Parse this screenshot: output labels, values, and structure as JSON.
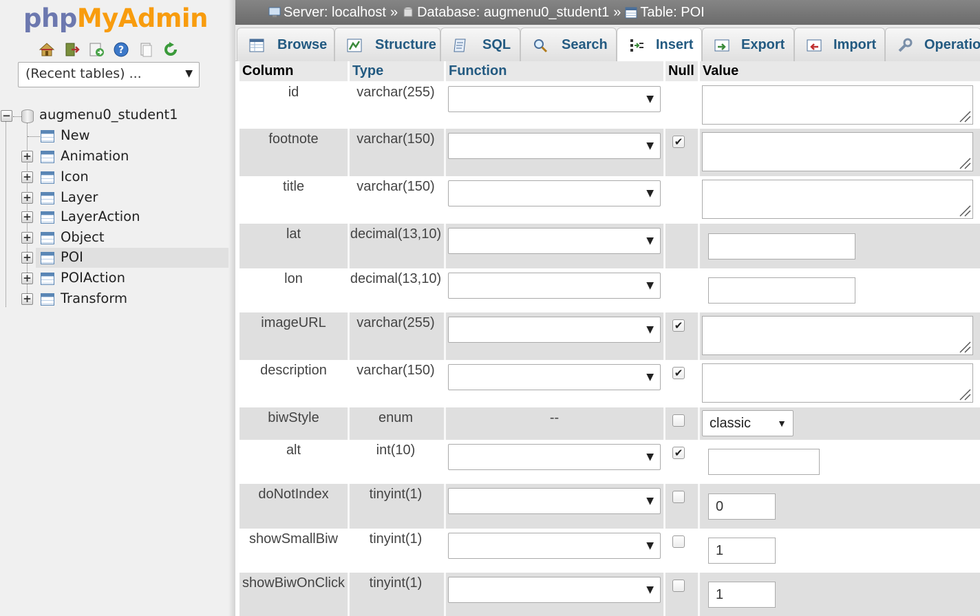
{
  "logo": {
    "part1": "php",
    "part2": "MyAdmin"
  },
  "nav_icons": [
    "home-icon",
    "exit-icon",
    "sql-query-icon",
    "help-icon",
    "documentation-icon",
    "reload-icon"
  ],
  "recent_tables": {
    "label": "(Recent tables) ...",
    "arrow": "▼"
  },
  "tree": {
    "database": "augmenu0_student1",
    "items": [
      {
        "label": "New"
      },
      {
        "label": "Animation"
      },
      {
        "label": "Icon"
      },
      {
        "label": "Layer"
      },
      {
        "label": "LayerAction"
      },
      {
        "label": "Object"
      },
      {
        "label": "POI"
      },
      {
        "label": "POIAction"
      },
      {
        "label": "Transform"
      }
    ]
  },
  "breadcrumb": {
    "server": "Server: localhost",
    "database": "Database: augmenu0_student1",
    "table": "Table: POI",
    "separator": "»"
  },
  "tabs": [
    {
      "label": "Browse",
      "icon": "browse-icon"
    },
    {
      "label": "Structure",
      "icon": "structure-icon"
    },
    {
      "label": "SQL",
      "icon": "sql-icon"
    },
    {
      "label": "Search",
      "icon": "search-icon"
    },
    {
      "label": "Insert",
      "icon": "insert-icon",
      "active": true
    },
    {
      "label": "Export",
      "icon": "export-icon"
    },
    {
      "label": "Import",
      "icon": "import-icon"
    },
    {
      "label": "Operatio",
      "icon": "operations-icon"
    }
  ],
  "columns": {
    "column": "Column",
    "type": "Type",
    "function": "Function",
    "null": "Null",
    "value": "Value"
  },
  "fields": [
    {
      "name": "id",
      "type": "varchar(255)",
      "function": "",
      "null_checked": null,
      "input": "textarea",
      "value": ""
    },
    {
      "name": "footnote",
      "type": "varchar(150)",
      "function": "",
      "null_checked": true,
      "input": "textarea",
      "value": ""
    },
    {
      "name": "title",
      "type": "varchar(150)",
      "function": "",
      "null_checked": null,
      "input": "textarea",
      "value": ""
    },
    {
      "name": "lat",
      "type": "decimal(13,10)",
      "function": "",
      "null_checked": null,
      "input": "text",
      "value": ""
    },
    {
      "name": "lon",
      "type": "decimal(13,10)",
      "function": "",
      "null_checked": null,
      "input": "text",
      "value": ""
    },
    {
      "name": "imageURL",
      "type": "varchar(255)",
      "function": "",
      "null_checked": true,
      "input": "textarea",
      "value": ""
    },
    {
      "name": "description",
      "type": "varchar(150)",
      "function": "",
      "null_checked": true,
      "input": "textarea",
      "value": ""
    },
    {
      "name": "biwStyle",
      "type": "enum",
      "function": "--",
      "null_checked": false,
      "input": "select",
      "value": "classic"
    },
    {
      "name": "alt",
      "type": "int(10)",
      "function": "",
      "null_checked": true,
      "input": "text",
      "value": ""
    },
    {
      "name": "doNotIndex",
      "type": "tinyint(1)",
      "function": "",
      "null_checked": false,
      "input": "text",
      "value": "0"
    },
    {
      "name": "showSmallBiw",
      "type": "tinyint(1)",
      "function": "",
      "null_checked": false,
      "input": "text",
      "value": "1"
    },
    {
      "name": "showBiwOnClick",
      "type": "tinyint(1)",
      "function": "",
      "null_checked": false,
      "input": "text",
      "value": "1"
    }
  ],
  "ui_colors": {
    "link": "#235a81",
    "logo_php": "#6c78af",
    "logo_admin": "#f89c0e",
    "row_alt": "#dfdfdf"
  }
}
